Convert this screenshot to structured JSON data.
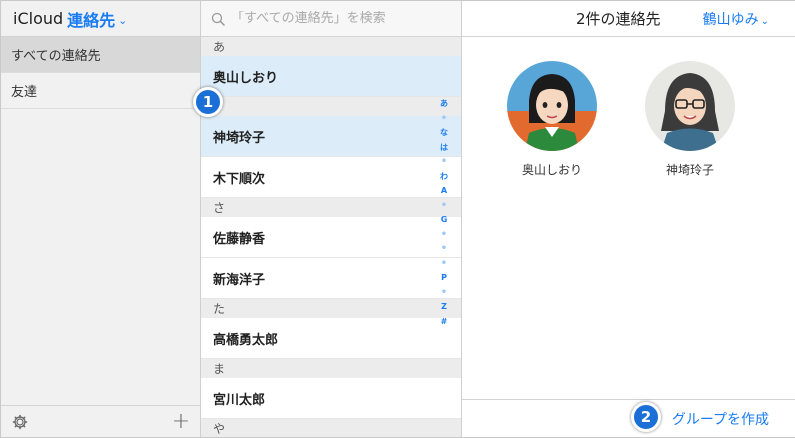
{
  "sidebar": {
    "brand": "iCloud",
    "app_name": "連絡先",
    "chevron": "⌄",
    "groups": [
      {
        "label": "すべての連絡先",
        "selected": true
      },
      {
        "label": "友達",
        "selected": false
      }
    ],
    "footer": {
      "settings_icon": "gear-icon",
      "add_icon": "plus-icon",
      "add_glyph": "+"
    }
  },
  "list": {
    "search_placeholder": "「すべての連絡先」を検索",
    "sections": [
      {
        "header": "あ",
        "contacts": [
          {
            "name": "奥山しおり",
            "selected": true
          }
        ]
      },
      {
        "header": "",
        "contacts": [
          {
            "name": "神埼玲子",
            "selected": true
          },
          {
            "name": "木下順次",
            "selected": false
          }
        ]
      },
      {
        "header": "さ",
        "contacts": [
          {
            "name": "佐藤静香",
            "selected": false
          },
          {
            "name": "新海洋子",
            "selected": false
          }
        ]
      },
      {
        "header": "た",
        "contacts": [
          {
            "name": "高橋勇太郎",
            "selected": false
          }
        ]
      },
      {
        "header": "ま",
        "contacts": [
          {
            "name": "宮川太郎",
            "selected": false
          }
        ]
      },
      {
        "header": "や",
        "contacts": []
      }
    ],
    "index": [
      "あ",
      "•",
      "な",
      "は",
      "•",
      "わ",
      "A",
      "•",
      "G",
      "•",
      "•",
      "•",
      "P",
      "•",
      "Z",
      "#"
    ]
  },
  "detail": {
    "count_text": "2件の連絡先",
    "user_name": "鶴山ゆみ",
    "user_chevron": "⌄",
    "cards": [
      {
        "name": "奥山しおり"
      },
      {
        "name": "神埼玲子"
      }
    ],
    "create_group_label": "グループを作成"
  },
  "callouts": [
    "1",
    "2"
  ],
  "colors": {
    "accent": "#1a7cf2",
    "badge": "#1b6fd6",
    "selected_row": "#dcecf8"
  }
}
